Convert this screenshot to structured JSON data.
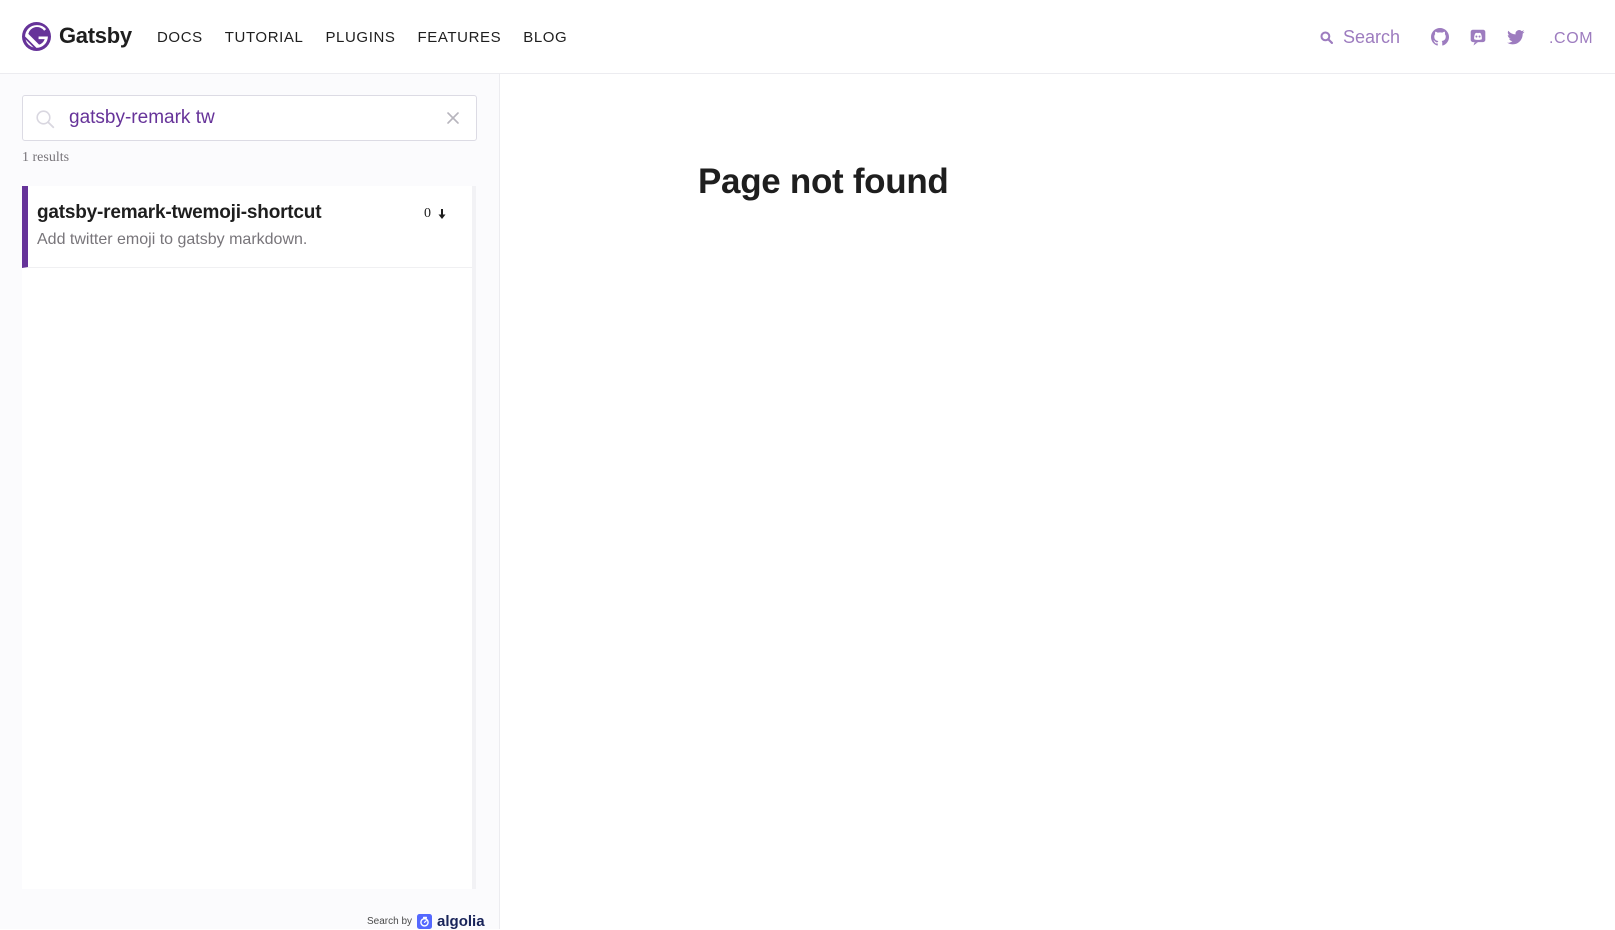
{
  "header": {
    "brand": "Gatsby",
    "nav": [
      "DOCS",
      "TUTORIAL",
      "PLUGINS",
      "FEATURES",
      "BLOG"
    ],
    "search_label": "Search",
    "social_icons": [
      "github-icon",
      "discord-icon",
      "twitter-icon"
    ],
    "dotcom": ".COM"
  },
  "sidebar": {
    "search_value": "gatsby-remark tw",
    "results_count": "1 results",
    "results": [
      {
        "title": "gatsby-remark-twemoji-shortcut",
        "description": "Add twitter emoji to gatsby markdown.",
        "downloads": "0"
      }
    ],
    "algolia_prefix": "Search by",
    "algolia_name": "algolia"
  },
  "main": {
    "title": "Page not found"
  },
  "colors": {
    "brand_purple": "#663399",
    "accent_light_purple": "#9d7cbf",
    "text_dark": "#1e1e1e",
    "text_muted": "#78757a",
    "algolia_blue": "#5468ff"
  }
}
